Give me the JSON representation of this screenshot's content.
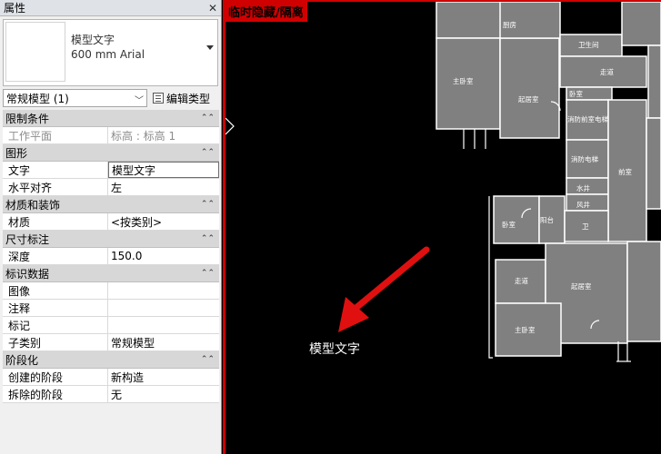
{
  "properties": {
    "title": "属性",
    "type_name_line1": "模型文字",
    "type_name_line2": "600 mm Arial",
    "filter": "常规模型 (1)",
    "edit_type": "编辑类型",
    "categories": [
      {
        "name": "限制条件",
        "rows": [
          {
            "key": "工作平面",
            "value": "标高 : 标高 1",
            "dim": true
          }
        ]
      },
      {
        "name": "图形",
        "rows": [
          {
            "key": "文字",
            "value": "模型文字"
          },
          {
            "key": "水平对齐",
            "value": "左"
          }
        ]
      },
      {
        "name": "材质和装饰",
        "rows": [
          {
            "key": "材质",
            "value": "<按类别>"
          }
        ]
      },
      {
        "name": "尺寸标注",
        "rows": [
          {
            "key": "深度",
            "value": "150.0"
          }
        ]
      },
      {
        "name": "标识数据",
        "rows": [
          {
            "key": "图像",
            "value": ""
          },
          {
            "key": "注释",
            "value": ""
          },
          {
            "key": "标记",
            "value": ""
          },
          {
            "key": "子类别",
            "value": "常规模型"
          }
        ]
      },
      {
        "name": "阶段化",
        "rows": [
          {
            "key": "创建的阶段",
            "value": "新构造"
          },
          {
            "key": "拆除的阶段",
            "value": "无"
          }
        ]
      }
    ]
  },
  "canvas": {
    "banner": "临时隐藏/隔离",
    "model_text": "模型文字",
    "rooms": [
      "厨房",
      "卫生间",
      "主卧室",
      "起居室",
      "走道",
      "卧室",
      "前室",
      "消防前室电梯",
      "消防电梯",
      "水井",
      "风井",
      "卫",
      "起居室",
      "卧室",
      "主卧室",
      "阳台",
      "走道"
    ]
  },
  "colors": {
    "accent_red": "#d10000"
  }
}
